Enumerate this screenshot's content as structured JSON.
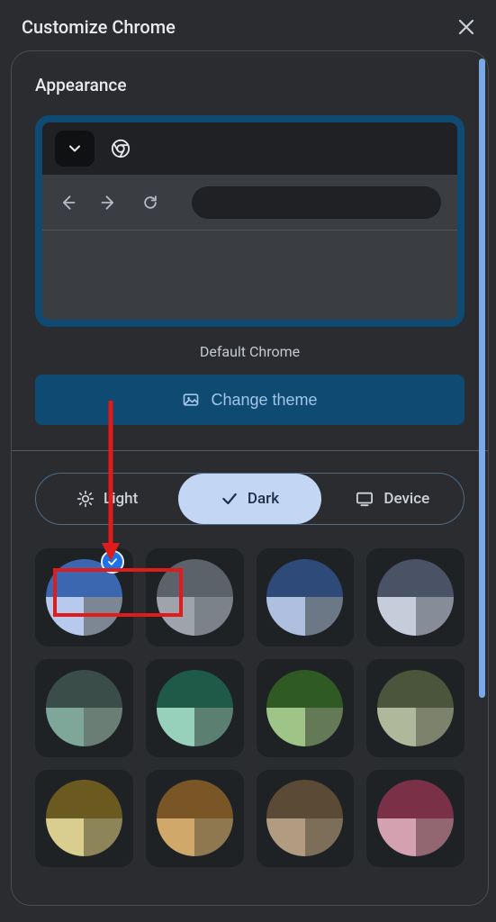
{
  "header": {
    "title": "Customize Chrome"
  },
  "appearance": {
    "section_title": "Appearance",
    "theme_name": "Default Chrome",
    "change_theme_label": "Change theme"
  },
  "modes": {
    "light_label": "Light",
    "dark_label": "Dark",
    "device_label": "Device",
    "selected": "Dark"
  },
  "annotation": {
    "highlight_target": "Light",
    "arrow_color": "#e01b1b"
  },
  "swatches": [
    {
      "top": "#3b66b0",
      "bl": "#b7c9ec",
      "br": "#7d8794",
      "selected": true
    },
    {
      "top": "#5b6269",
      "bl": "#9ea4ab",
      "br": "#7b828a",
      "selected": false
    },
    {
      "top": "#2e4a78",
      "bl": "#aebfe0",
      "br": "#6d7886",
      "selected": false
    },
    {
      "top": "#4a5266",
      "bl": "#c6cdda",
      "br": "#868d99",
      "selected": false
    },
    {
      "top": "#3a4d49",
      "bl": "#7ea79a",
      "br": "#6b7e76",
      "selected": false
    },
    {
      "top": "#1f5a49",
      "bl": "#97d0bb",
      "br": "#5b7f70",
      "selected": false
    },
    {
      "top": "#2f5a23",
      "bl": "#9ec487",
      "br": "#647a56",
      "selected": false
    },
    {
      "top": "#4b553b",
      "bl": "#b0b89b",
      "br": "#7c826c",
      "selected": false
    },
    {
      "top": "#6b5a20",
      "bl": "#d9ce8f",
      "br": "#8d8559",
      "selected": false
    },
    {
      "top": "#7a5626",
      "bl": "#d0a96a",
      "br": "#8f7750",
      "selected": false
    },
    {
      "top": "#5b4a36",
      "bl": "#b19c82",
      "br": "#7d6e5a",
      "selected": false
    },
    {
      "top": "#7a3148",
      "bl": "#d3a1af",
      "br": "#926772",
      "selected": false
    }
  ]
}
